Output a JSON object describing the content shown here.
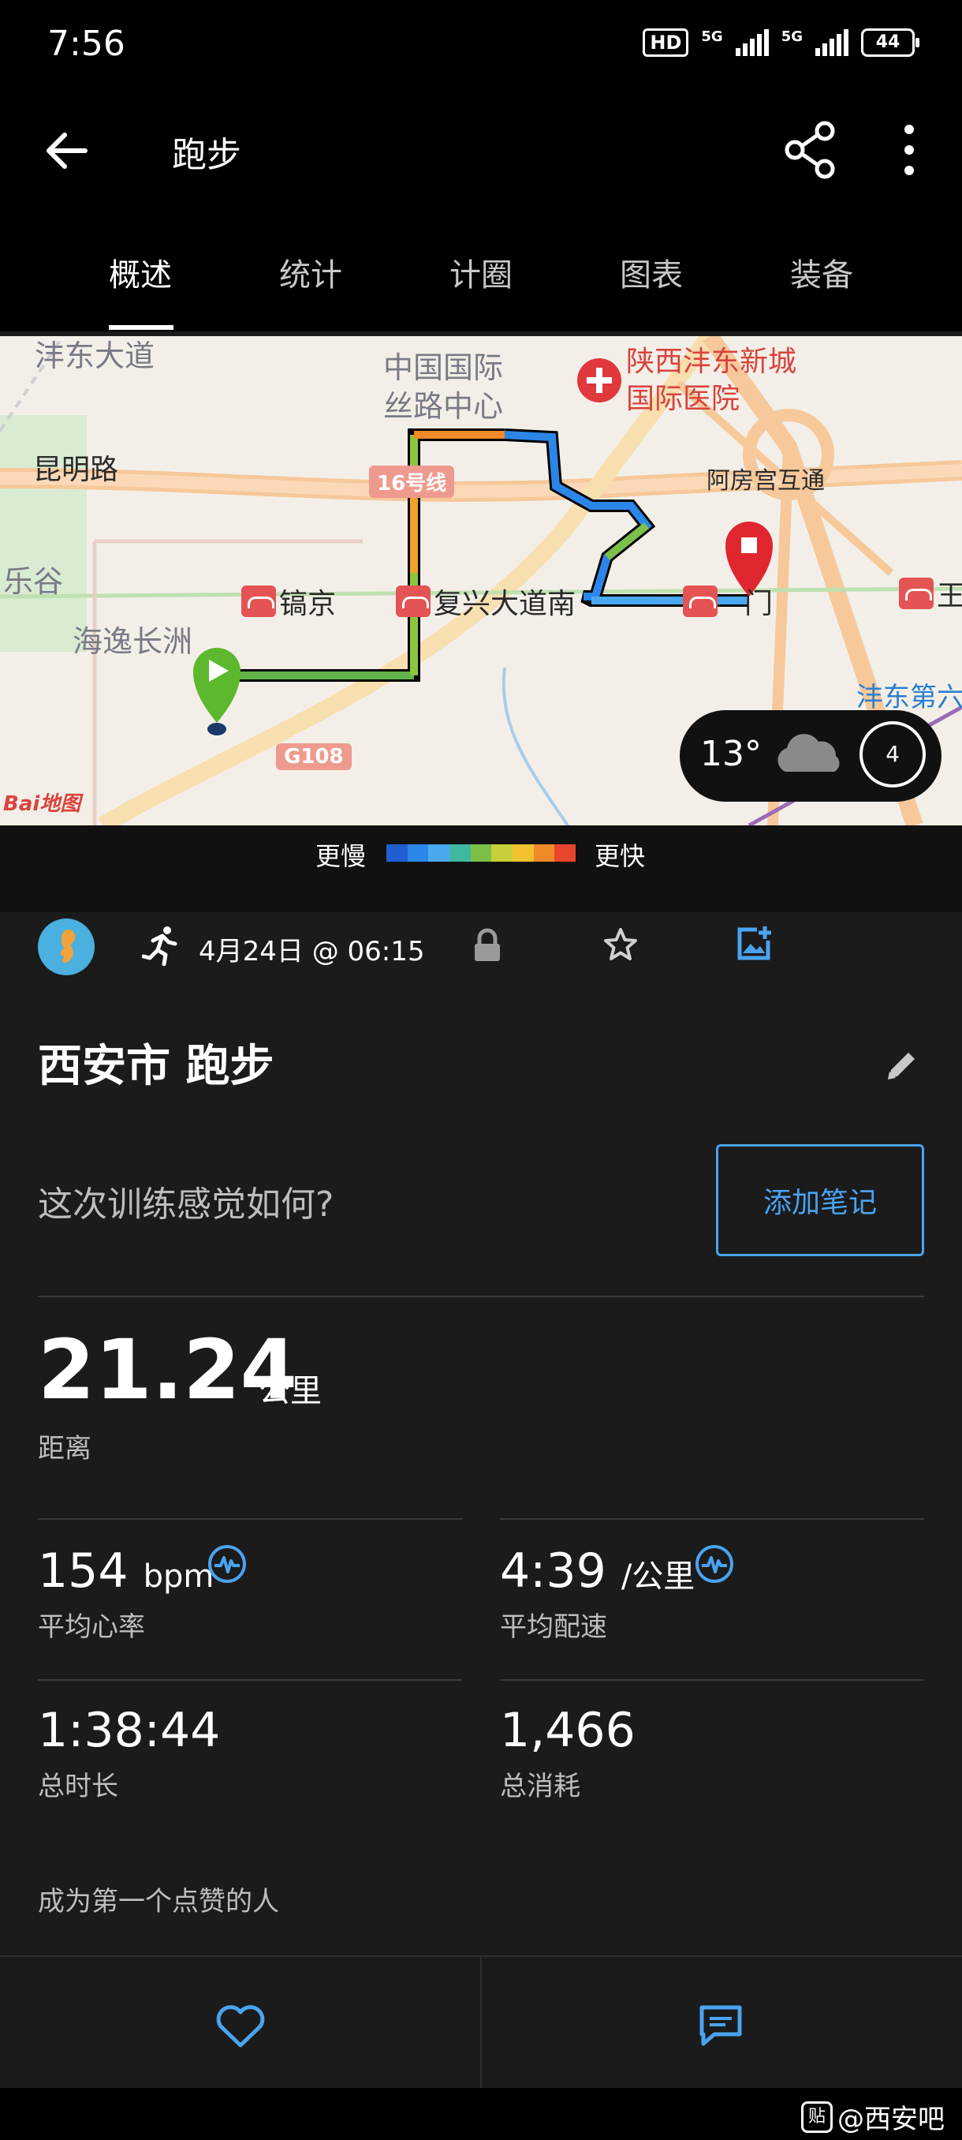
{
  "status_bar": {
    "time": "7:56",
    "hd": "HD",
    "network_1": "5G",
    "network_2": "5G",
    "battery": "44"
  },
  "app_bar": {
    "title": "跑步",
    "icons": [
      "back-arrow-icon",
      "share-icon",
      "more-vert-icon"
    ]
  },
  "tabs": [
    {
      "label": "概述",
      "active": true
    },
    {
      "label": "统计",
      "active": false
    },
    {
      "label": "计圈",
      "active": false
    },
    {
      "label": "图表",
      "active": false
    },
    {
      "label": "装备",
      "active": false
    }
  ],
  "map": {
    "labels": {
      "road_top": "沣东大道",
      "kunming": "昆明路",
      "legu": "乐谷",
      "haiyi": "海逸长洲",
      "silk_road": "中国国际\n丝路中心",
      "hospital": "陕西沣东新城\n国际医院",
      "efang": "阿房宫互通",
      "gaojing": "镐京",
      "fuxing": "复兴大道南",
      "gate": "门",
      "wang": "王",
      "fengdong_school": "沣东第六\n小学",
      "line16": "16号线",
      "g108": "G108",
      "baidu": "Bai地图"
    },
    "weather": {
      "temp": "13°",
      "wind": "4",
      "icon": "cloud-icon"
    }
  },
  "legend": {
    "slower": "更慢",
    "faster": "更快",
    "colors": [
      "#1f5fd1",
      "#2b86e8",
      "#4aa8f0",
      "#3fb8a0",
      "#7cc04a",
      "#c7cf3a",
      "#f2c230",
      "#f08a2a",
      "#e8452e"
    ]
  },
  "activity": {
    "date": "4月24日 @ 06:15",
    "title": "西安市 跑步",
    "feel_question": "这次训练感觉如何?",
    "add_note": "添加笔记"
  },
  "stats": {
    "distance": {
      "value": "21.24",
      "unit": "公里",
      "label": "距离"
    },
    "heart_rate": {
      "value": "154",
      "unit": "bpm",
      "label": "平均心率"
    },
    "pace": {
      "value": "4:39",
      "unit": "/公里",
      "label": "平均配速"
    },
    "duration": {
      "value": "1:38:44",
      "label": "总时长"
    },
    "calories": {
      "value": "1,466",
      "label": "总消耗"
    }
  },
  "social": {
    "likes_text": "成为第一个点赞的人"
  },
  "footer": {
    "tieba": "贴",
    "watermark": "@西安吧"
  },
  "accent_color": "#4aa3f0"
}
